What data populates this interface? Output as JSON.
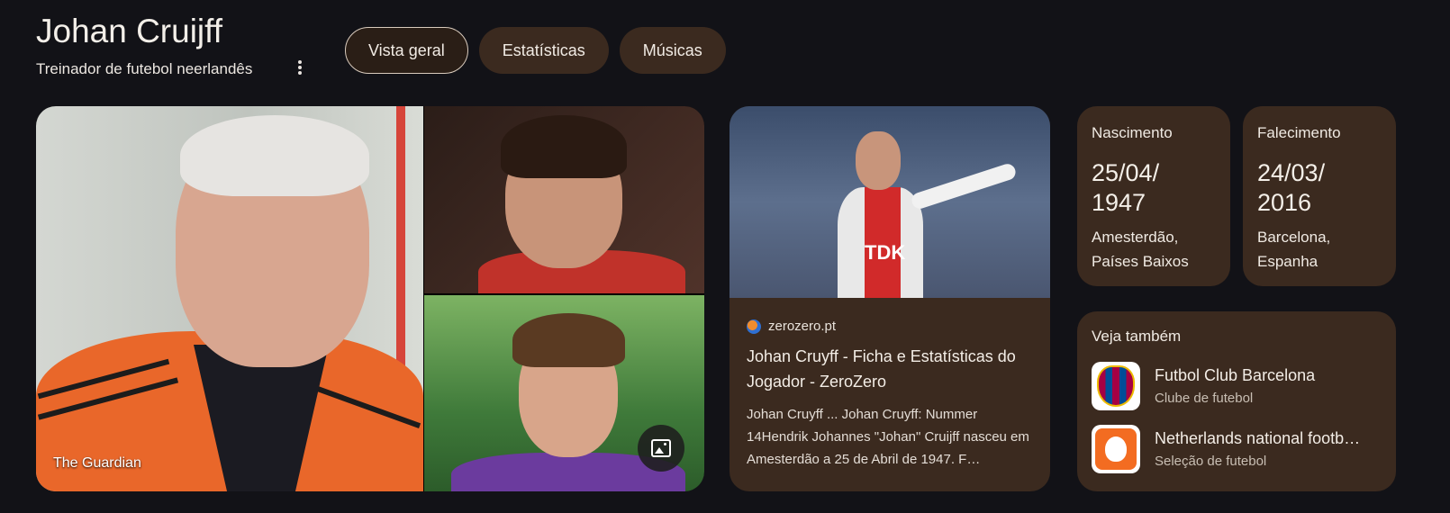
{
  "entity": {
    "name": "Johan Cruijff",
    "description": "Treinador de futebol neerlandês"
  },
  "tabs": [
    {
      "label": "Vista geral",
      "active": true
    },
    {
      "label": "Estatísticas",
      "active": false
    },
    {
      "label": "Músicas",
      "active": false
    }
  ],
  "images": {
    "main_caption": "The Guardian"
  },
  "article": {
    "source": "zerozero.pt",
    "title": "Johan Cruyff - Ficha e Estatísticas do Jogador - ZeroZero",
    "snippet": "Johan Cruyff ... Johan Cruyff: Nummer 14Hendrik Johannes \"Johan\" Cruijff nasceu em Amesterdão a 25 de Abril de 1947. F…",
    "photo_text": "TDK"
  },
  "facts": {
    "birth": {
      "label": "Nascimento",
      "date_line1": "25/04/",
      "date_line2": "1947",
      "place_line1": "Amesterdão,",
      "place_line2": "Países Baixos"
    },
    "death": {
      "label": "Falecimento",
      "date_line1": "24/03/",
      "date_line2": "2016",
      "place_line1": "Barcelona,",
      "place_line2": "Espanha"
    }
  },
  "see_also": {
    "heading": "Veja também",
    "items": [
      {
        "title": "Futbol Club Barcelona",
        "subtitle": "Clube de futebol",
        "icon": "fcb-crest-icon"
      },
      {
        "title": "Netherlands national footb…",
        "subtitle": "Seleção de futebol",
        "icon": "knvb-crest-icon"
      }
    ]
  },
  "colors": {
    "background": "#121217",
    "card": "#3b2a1f",
    "text": "#f3ede6"
  }
}
